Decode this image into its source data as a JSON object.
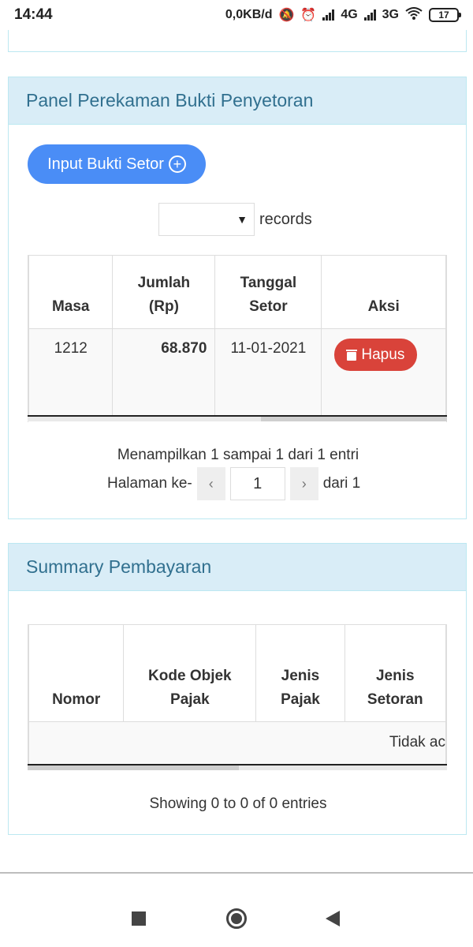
{
  "status_bar": {
    "time": "14:44",
    "net_speed": "0,0KB/d",
    "net1": "4G",
    "net2": "3G",
    "battery": "17"
  },
  "panel_rekam": {
    "title": "Panel Perekaman Bukti Penyetoran",
    "input_button_label": "Input Bukti Setor",
    "records_selected": "",
    "records_label": "records",
    "columns": [
      "Masa",
      "Jumlah (Rp)",
      "Tanggal Setor",
      "Aksi"
    ],
    "rows": [
      {
        "masa": "1212",
        "jumlah": "68.870",
        "tanggal": "11-01-2021",
        "aksi": "Hapus"
      }
    ],
    "info": "Menampilkan 1 sampai 1 dari 1 entri",
    "pager_prefix": "Halaman ke-",
    "pager_current": "1",
    "pager_suffix": "dari 1"
  },
  "panel_summary": {
    "title": "Summary Pembayaran",
    "columns": [
      "Nomor",
      "Kode Objek Pajak",
      "Jenis Pajak",
      "Jenis Setoran"
    ],
    "empty_text": "Tidak ac",
    "info": "Showing 0 to 0 of 0 entries"
  }
}
